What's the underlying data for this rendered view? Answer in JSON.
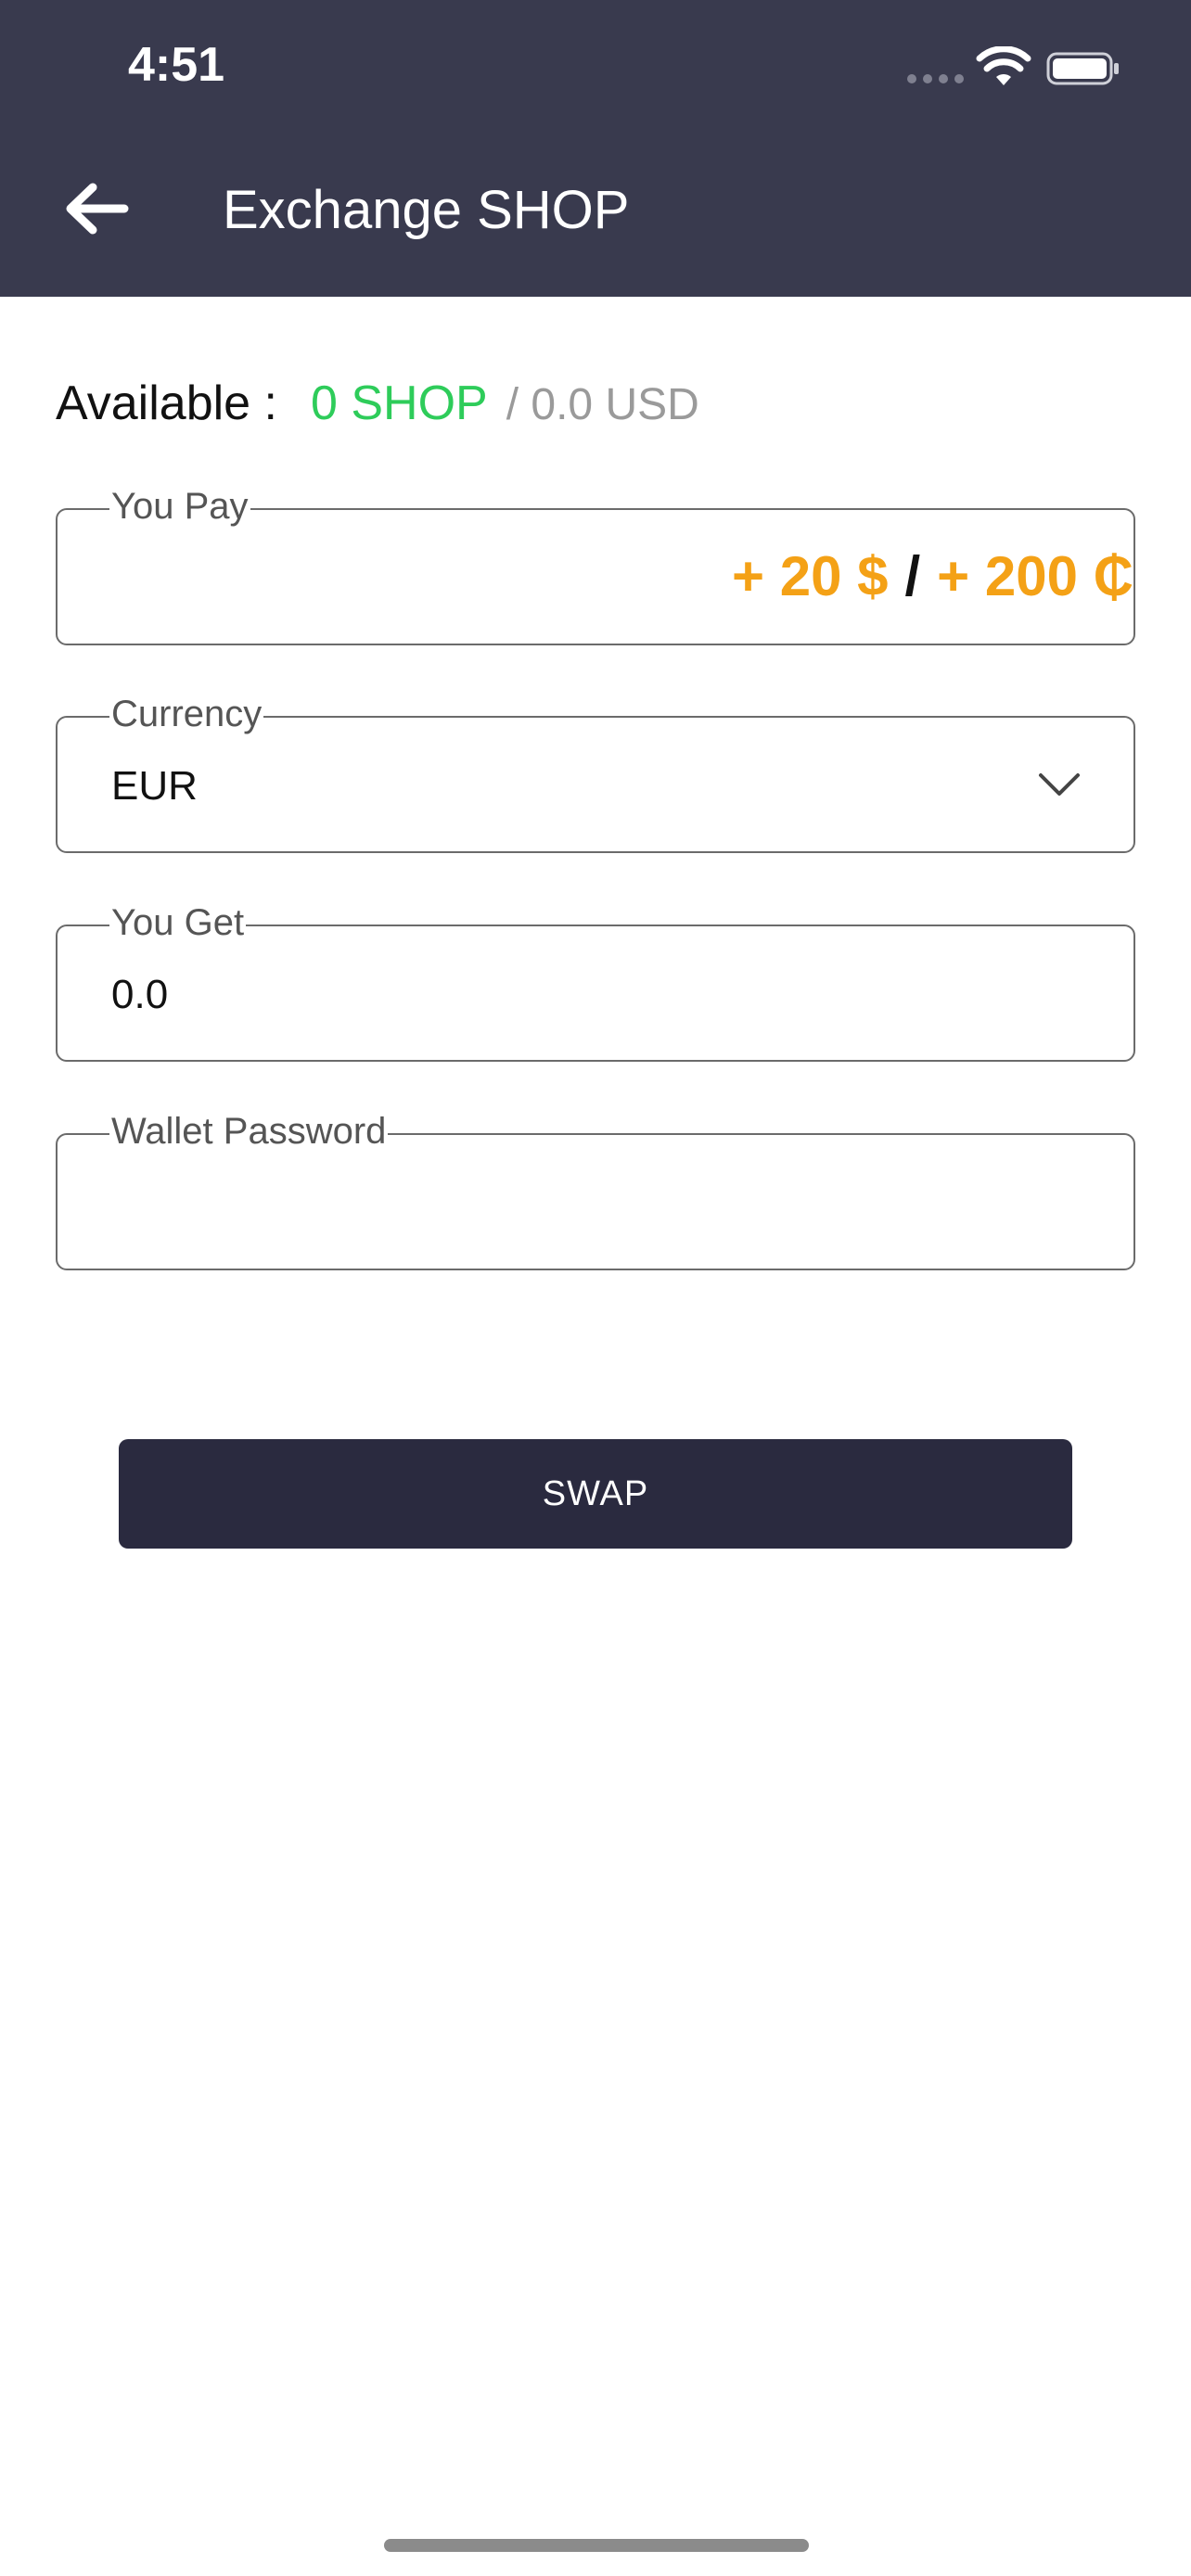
{
  "status_bar": {
    "time": "4:51"
  },
  "appbar": {
    "title": "Exchange SHOP",
    "back_icon": "arrow-left-icon"
  },
  "balance": {
    "label": "Available :",
    "shop_amount": "0 SHOP",
    "usd_amount": "/ 0.0 USD"
  },
  "pay_field": {
    "label": "You Pay",
    "usd_value": "+ 20 $",
    "separator": "/",
    "coin_value": "+ 200 ₵"
  },
  "currency_field": {
    "label": "Currency",
    "selected": "EUR",
    "icon": "chevron-down-icon"
  },
  "get_field": {
    "label": "You Get",
    "value": "0.0"
  },
  "password_field": {
    "label": "Wallet Password",
    "value": ""
  },
  "swap_button": {
    "label": "SWAP"
  },
  "colors": {
    "appbar": "#393a4e",
    "shop_green": "#2ecc5a",
    "pay_orange": "#f4a116",
    "button": "#2a2a3f"
  }
}
